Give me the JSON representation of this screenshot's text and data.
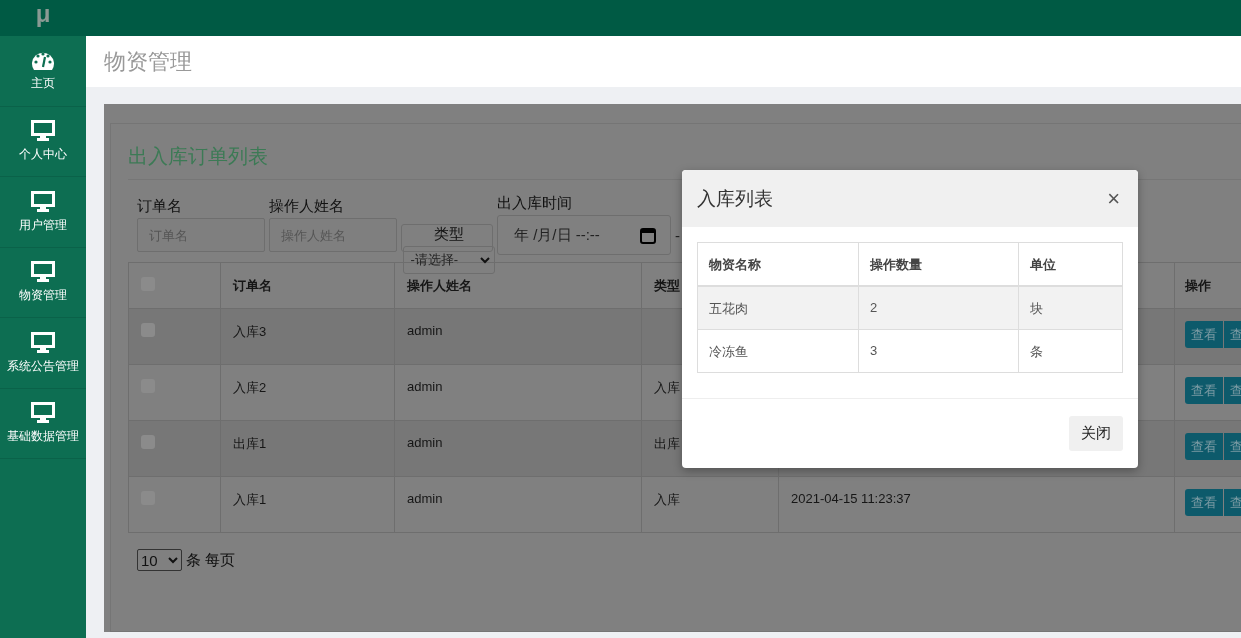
{
  "sidebar": {
    "logo": "μ",
    "items": [
      {
        "label": "主页",
        "kind": "gauge"
      },
      {
        "label": "个人中心",
        "kind": "monitor"
      },
      {
        "label": "用户管理",
        "kind": "monitor"
      },
      {
        "label": "物资管理",
        "kind": "monitor"
      },
      {
        "label": "系统公告管理",
        "kind": "monitor"
      },
      {
        "label": "基础数据管理",
        "kind": "monitor"
      }
    ]
  },
  "header": {
    "title": "物资管理"
  },
  "panel": {
    "title": "出入库订单列表",
    "filters": [
      {
        "kind": "text",
        "label": "订单名",
        "placeholder": "订单名"
      },
      {
        "kind": "text",
        "label": "操作人姓名",
        "placeholder": "操作人姓名"
      },
      {
        "kind": "select",
        "label": "类型",
        "value": "-请选择-"
      },
      {
        "kind": "datetime",
        "label": "出入库时间",
        "value": "年 /月/日 --:--"
      }
    ],
    "range_separator": "-",
    "table": {
      "select_all_checked": false,
      "columns": [
        "订单名",
        "操作人姓名",
        "类型",
        "操作"
      ],
      "rows": [
        {
          "checked": false,
          "order": "入库3",
          "operator": "admin",
          "actions": [
            "查看",
            "查"
          ]
        },
        {
          "checked": false,
          "order": "入库2",
          "operator": "admin",
          "type": "入库",
          "actions": [
            "查看",
            "查"
          ]
        },
        {
          "checked": false,
          "order": "出库1",
          "operator": "admin",
          "type": "出库",
          "actions": [
            "查看",
            "查"
          ]
        },
        {
          "checked": false,
          "order": "入库1",
          "operator": "admin",
          "type": "入库",
          "time": "2021-04-15 11:23:37",
          "actions": [
            "查看",
            "查"
          ]
        }
      ]
    },
    "page_size": {
      "value": "10",
      "suffix": "条 每页"
    }
  },
  "modal": {
    "title": "入库列表",
    "close": "×",
    "columns": [
      "物资名称",
      "操作数量",
      "单位"
    ],
    "rows": [
      [
        "五花肉",
        "2",
        "块"
      ],
      [
        "冷冻鱼",
        "3",
        "条"
      ]
    ],
    "button": "关闭"
  }
}
